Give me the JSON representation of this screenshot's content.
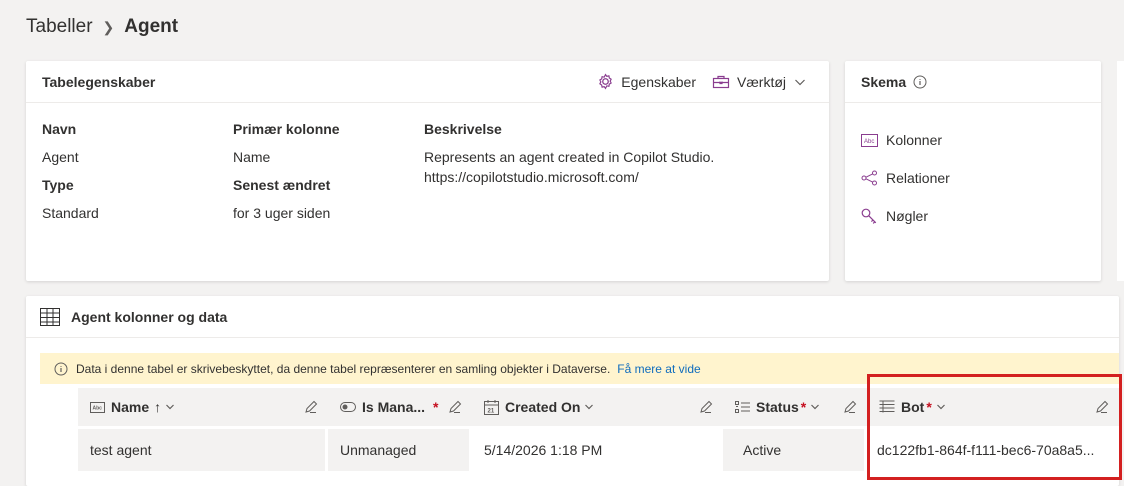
{
  "breadcrumb": {
    "parent": "Tabeller",
    "current": "Agent"
  },
  "table_properties": {
    "title": "Tabelegenskaber",
    "properties_action": "Egenskaber",
    "tools_action": "Værktøj",
    "name_label": "Navn",
    "name_value": "Agent",
    "type_label": "Type",
    "type_value": "Standard",
    "primary_label": "Primær kolonne",
    "primary_value": "Name",
    "modified_label": "Senest ændret",
    "modified_value": "for 3 uger siden",
    "desc_label": "Beskrivelse",
    "desc_line1": "Represents an agent created in Copilot Studio.",
    "desc_line2": "https://copilotstudio.microsoft.com/"
  },
  "schema": {
    "title": "Skema",
    "items": [
      {
        "label": "Kolonner",
        "icon": "text-column-icon"
      },
      {
        "label": "Relationer",
        "icon": "relations-icon"
      },
      {
        "label": "Nøgler",
        "icon": "key-icon"
      }
    ]
  },
  "data_section": {
    "title": "Agent kolonner og data",
    "info_text": "Data i denne tabel er skrivebeskyttet, da denne tabel repræsenterer en samling objekter i Dataverse.",
    "info_link": "Få mere at vide"
  },
  "grid": {
    "columns": [
      {
        "label": "Name",
        "sort": "↑",
        "required": "",
        "icon": "text-column-icon"
      },
      {
        "label": "Is Mana...",
        "sort": "",
        "required": "*",
        "icon": "toggle-icon"
      },
      {
        "label": "Created On",
        "sort": "",
        "required": "",
        "icon": "calendar-icon"
      },
      {
        "label": "Status",
        "sort": "",
        "required": "*",
        "icon": "choice-list-icon"
      },
      {
        "label": "Bot",
        "sort": "",
        "required": "*",
        "icon": "lookup-icon"
      }
    ],
    "rows": [
      [
        "test agent",
        "Unmanaged",
        "5/14/2026 1:18 PM",
        "Active",
        "dc122fb1-864f-f111-bec6-70a8a5..."
      ]
    ]
  },
  "colors": {
    "accent": "#0f6cbd",
    "highlight": "#d32020",
    "required": "#c50f1f",
    "icon_purple": "#8a3d8f"
  }
}
